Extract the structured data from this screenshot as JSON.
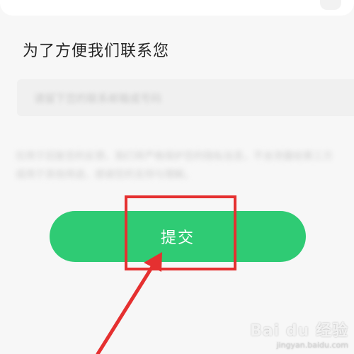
{
  "form": {
    "contact_title": "为了方便我们联系您",
    "contact_placeholder": "请留下您的联系邮箱或号码",
    "privacy_note": "仅用于回复您的反馈，我们将严格保护您的隐私信息，不会泄露给第三方或用于其他用途，感谢您的支持与理解。"
  },
  "actions": {
    "submit_label": "提交"
  },
  "watermark": {
    "brand": "Bai du 经验",
    "url": "jingyan.baidu.com"
  },
  "colors": {
    "button": "#2fcb74",
    "annotation": "#e53030"
  }
}
